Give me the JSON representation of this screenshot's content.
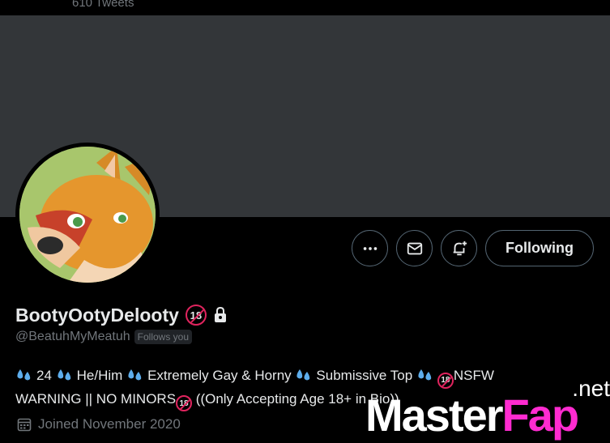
{
  "header": {
    "tweet_count": "610 Tweets"
  },
  "profile": {
    "display_name": "BootyOotyDelooty",
    "age_badge": "18",
    "handle": "@BeatuhMyMeatuh",
    "follows_you": "Follows you",
    "joined": "Joined November 2020",
    "bio": {
      "items": [
        "24",
        "He/Him",
        "Extremely Gay & Horny",
        "Submissive Top"
      ],
      "nsfw": "NSFW",
      "line2_a": "WARNING || NO MINORS",
      "line2_b": "((Only Accepting Age 18+ in Bio))"
    }
  },
  "actions": {
    "more_icon": "more-horizontal-icon",
    "message_icon": "mail-icon",
    "notify_icon": "bell-plus-icon",
    "follow_label": "Following"
  },
  "watermark": {
    "main": "Master",
    "accent": "Fap",
    "suffix": ".net"
  },
  "colors": {
    "background": "#000000",
    "banner": "#333639",
    "secondary_text": "#71767b",
    "border": "#536471",
    "watermark_accent": "#ff2bd0"
  }
}
